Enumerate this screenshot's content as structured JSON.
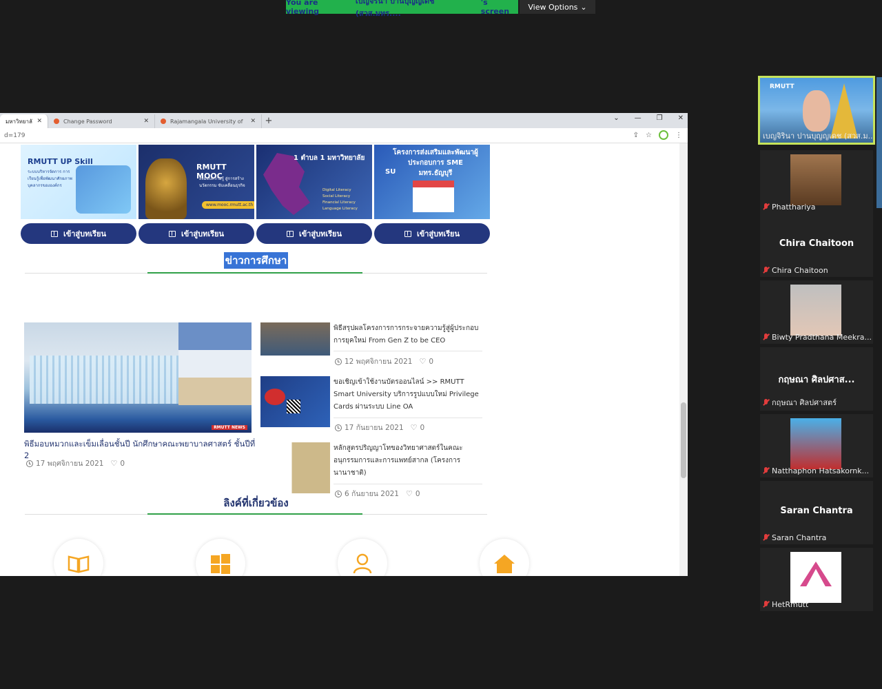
{
  "zoom": {
    "viewing_prefix": "You are viewing",
    "viewing_name": "เบญจิรินา ปานบุญญเดช (สวส.มทร....",
    "viewing_suffix": "'s screen",
    "view_options": "View Options"
  },
  "browser": {
    "tabs": [
      {
        "label": "มหาวิทยาลัยเทคโนโ"
      },
      {
        "label": "Change Password"
      },
      {
        "label": "Rajamangala University of Techn"
      }
    ],
    "address_fragment": "d=179"
  },
  "cards": [
    {
      "title": "RMUTT UP Skill",
      "subtitle": "ระบบบริหารจัดการ การเรียนรู้เพื่อพัฒนาศักยภาพบุคลากรขององค์กร"
    },
    {
      "title": "RMUTT MOOC",
      "subtitle": "ส่งมอบความรู้ สู่การสร้างนวัตกรรม ขับเคลื่อนธุรกิจ",
      "url": "www.mooc.rmutt.ac.th"
    },
    {
      "title": "1 ตำบล 1 มหาวิทยาลัย",
      "list": [
        "Digital Literacy",
        "Social Literacy",
        "Financial Literacy",
        "Language Literacy"
      ]
    },
    {
      "title": "โครงการส่งเสริมและพัฒนาผู้ประกอบการ SME มทร.ธัญบุรี",
      "badge": "SU"
    }
  ],
  "enter_label": "เข้าสู่บทเรียน",
  "sections": {
    "news_title": "ข่าวการศึกษา",
    "links_title": "ลิงค์ที่เกี่ยวข้อง"
  },
  "featured_news": {
    "title": "พิธีมอบหมวกและเข็มเลื่อนชั้นปี นักศึกษาคณะพยาบาลศาสตร์ ชั้นปีที่ 2",
    "date": "17 พฤศจิกายน 2021",
    "likes": "0",
    "logo": "RMUTT NEWS"
  },
  "news": [
    {
      "title": "พิธีสรุปผลโครงการการกระจายความรู้สู่ผู้ประกอบการยุคใหม่ From Gen Z to be CEO",
      "date": "12 พฤศจิกายน 2021",
      "likes": "0"
    },
    {
      "title": "ขอเชิญเข้าใช้งานบัตรออนไลน์ >> RMUTT Smart University บริการรูปแบบใหม่ Privilege Cards ผ่านระบบ Line OA",
      "date": "17 กันยายน 2021",
      "likes": "0"
    },
    {
      "title": "หลักสูตรปริญญาโทของวิทยาศาสตร์ในคณะอนุกรรมการและการแพทย์สากล (โครงการนานาชาติ)",
      "date": "6 กันยายน 2021",
      "likes": "0"
    }
  ],
  "participants": [
    {
      "name": "เบญจิรินา ปานบุญญเดช (สวส.ม...",
      "logo": "RMUTT"
    },
    {
      "name": "Phatthariya"
    },
    {
      "name": "Chira Chaitoon",
      "bigname": "Chira Chaitoon"
    },
    {
      "name": "Biwty Pradthana Meekra..."
    },
    {
      "name": "กฤษณา ศิลปศาสตร์",
      "bigname": "กฤษณา ศิลปศาส..."
    },
    {
      "name": "Natthaphon Hatsakornk..."
    },
    {
      "name": "Saran Chantra",
      "bigname": "Saran Chantra"
    },
    {
      "name": "HetRmutt"
    }
  ],
  "colors": {
    "zoom_green": "#22b14c",
    "navy": "#24377e",
    "accent_green": "#2fa047",
    "active_speaker": "#c6e35a",
    "icon_orange": "#f5a623"
  }
}
